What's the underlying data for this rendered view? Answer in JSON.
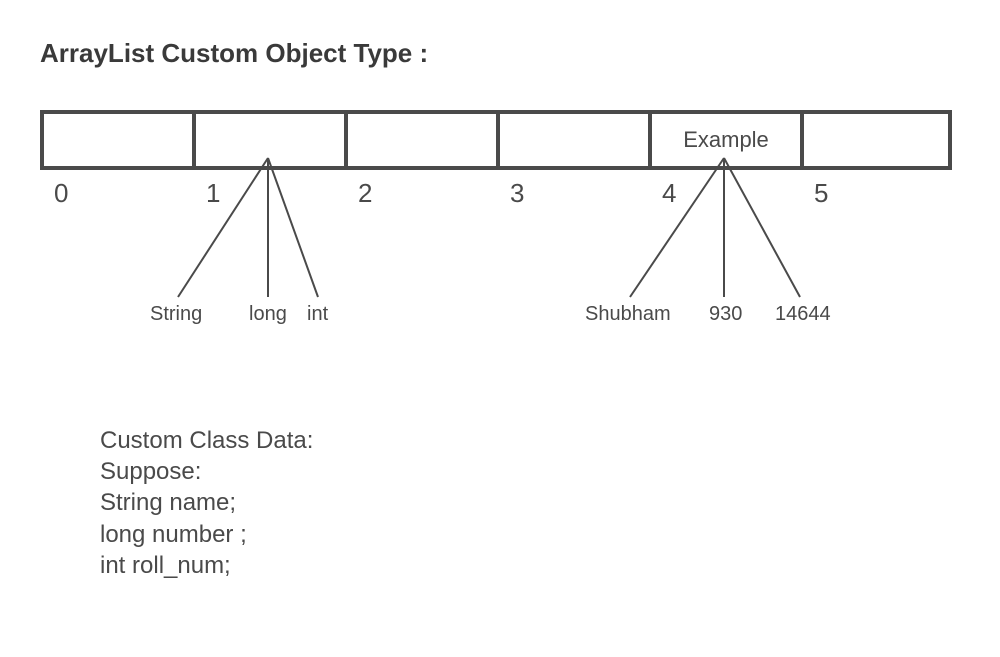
{
  "title": "ArrayList Custom Object Type :",
  "cells": [
    "",
    "",
    "",
    "",
    "Example",
    ""
  ],
  "indices": [
    "0",
    "1",
    "2",
    "3",
    "4",
    "5"
  ],
  "typeLabels": {
    "label1": "String",
    "label2": "long",
    "label3": "int"
  },
  "exampleLabels": {
    "label1": "Shubham",
    "label2": "930",
    "label3": "14644"
  },
  "classData": {
    "line1": "Custom Class Data:",
    "line2": "Suppose:",
    "line3": "String name;",
    "line4": "long number ;",
    "line5": "int roll_num;"
  }
}
